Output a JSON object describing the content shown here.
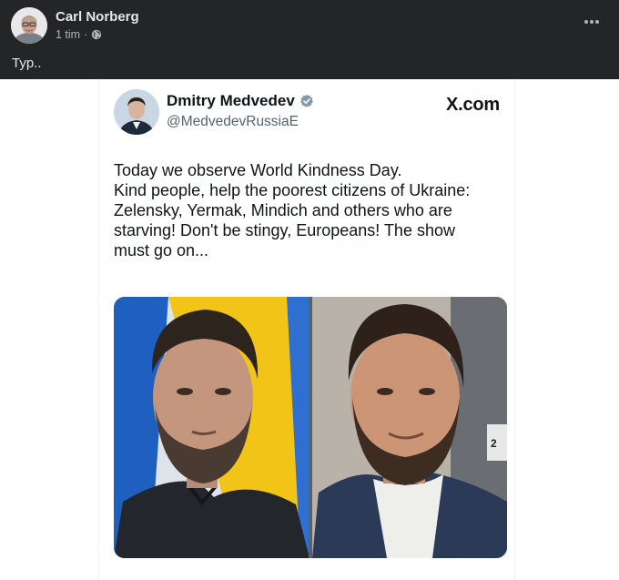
{
  "post": {
    "author": "Carl Norberg",
    "time": "1 tim",
    "separator": "·",
    "caption": "Typ.."
  },
  "tweet": {
    "name": "Dmitry Medvedev",
    "handle": "@MedvedevRussiaE",
    "brand": "X.com",
    "text_lines": [
      "Today we observe World Kindness Day.",
      "Kind people, help the poorest citizens of Ukraine:",
      "Zelensky, Yermak, Mindich and others who are",
      "starving! Don't be stingy, Europeans! The show",
      "must go on..."
    ],
    "photo_number_label": "2"
  },
  "icons": {
    "globe": "globe-icon",
    "more": "more-options-icon",
    "verified": "verified-badge-icon"
  },
  "colors": {
    "header_bg": "#242526",
    "header_text": "#e4e6eb",
    "meta_text": "#b0b3b8",
    "tweet_text": "#0f1419",
    "handle_text": "#536471",
    "flag_blue": "#1f5fbf",
    "flag_yellow": "#f2c418"
  }
}
